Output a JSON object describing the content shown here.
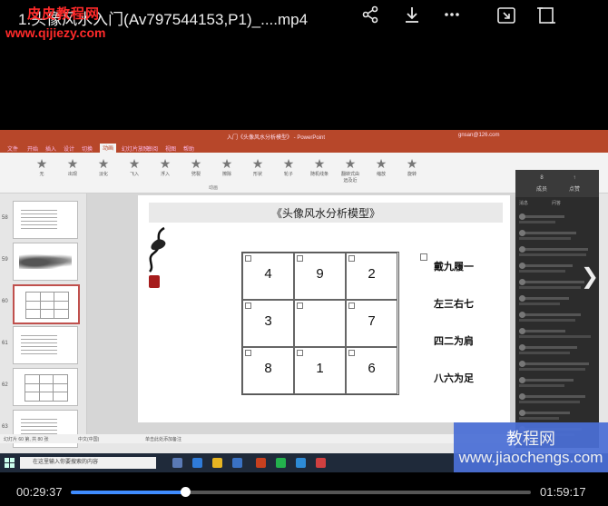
{
  "player": {
    "title": "1.头像风水入门(Av797544153,P1)_....mp4",
    "watermark_top": "皮皮教程网",
    "watermark_url": "www.qijiezy.com",
    "current_time": "00:29:37",
    "total_time": "01:59:17",
    "progress_fraction": 0.248
  },
  "ppt": {
    "window_title": "入门《头像风水分析模型》 - PowerPoint",
    "account": "gnsan@126.com",
    "tabs": [
      "文件",
      "开始",
      "插入",
      "设计",
      "切换",
      "动画",
      "幻灯片放映",
      "审阅",
      "视图",
      "帮助"
    ],
    "active_tab": "动画",
    "ribbon_items": [
      "无",
      "出现",
      "淡化",
      "飞入",
      "浮入",
      "劈裂",
      "擦除",
      "形状",
      "轮子",
      "随机线条",
      "翻转式由远及近",
      "缩放",
      "旋转"
    ],
    "ribbon_group": "动画",
    "slide_numbers": [
      "58",
      "59",
      "60",
      "61",
      "62",
      "63"
    ],
    "status_left": "幻灯片 60 第, 共 80 张",
    "status_lang": "中文(中国)",
    "notes_hint": "单击此处添加备注"
  },
  "slide": {
    "title": "《头像风水分析模型》",
    "grid": [
      [
        "4",
        "9",
        "2"
      ],
      [
        "3",
        "",
        "7"
      ],
      [
        "8",
        "1",
        "6"
      ]
    ],
    "side_lines": [
      "戴九履一",
      "左三右七",
      "四二为肩",
      "八六为足"
    ]
  },
  "chat": {
    "header_a_count": "8",
    "header_a_label": "成员",
    "header_b_label": "点赞",
    "tabs": [
      "消息",
      "问答"
    ]
  },
  "taskbar": {
    "search_placeholder": "在这里输入你要搜索的内容"
  },
  "watermark_br": {
    "cn": "教程网",
    "url": "www.jiaochengs.com"
  }
}
